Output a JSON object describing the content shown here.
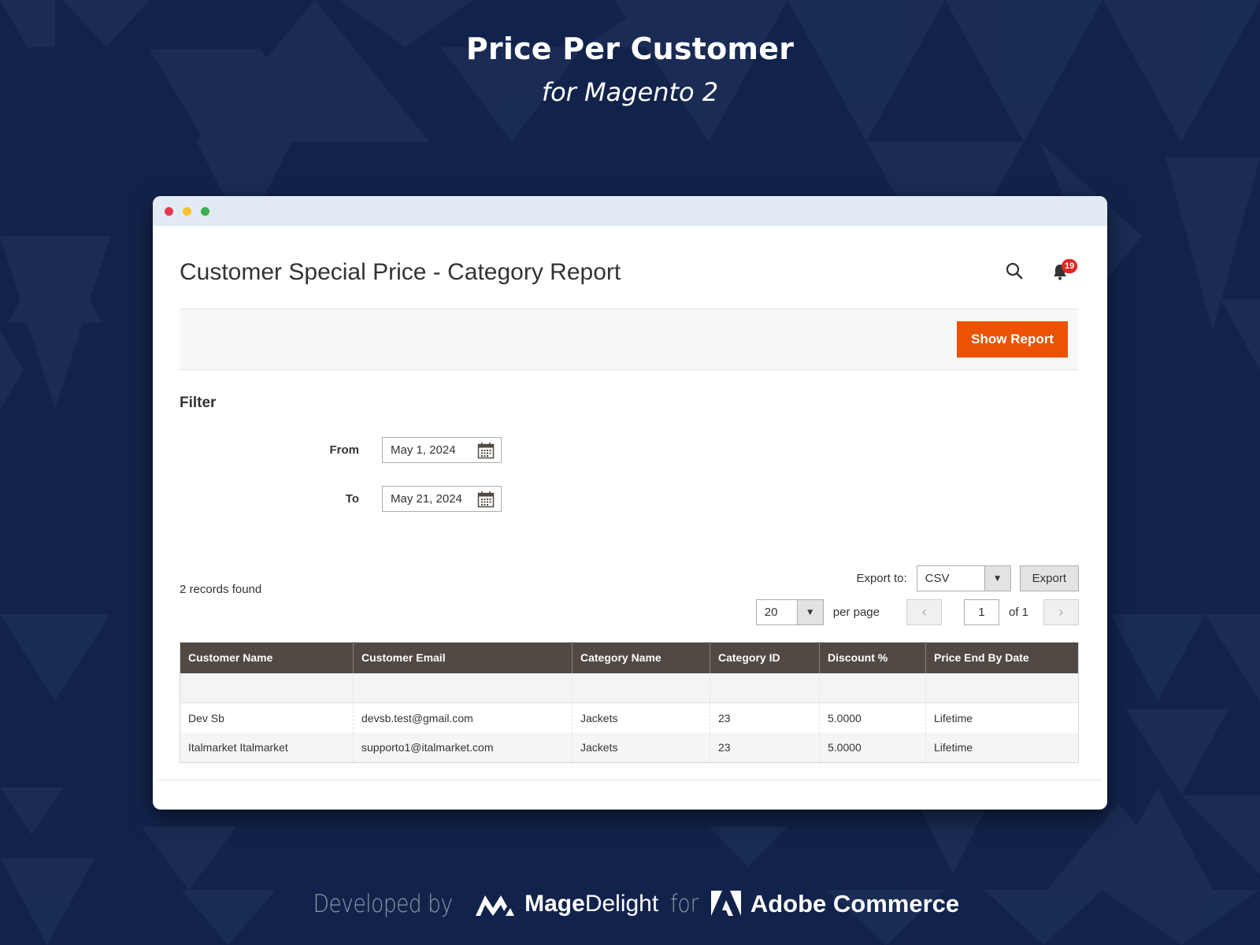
{
  "hero": {
    "title": "Price Per Customer",
    "subtitle": "for Magento 2"
  },
  "window": {
    "controls": [
      "close",
      "minimize",
      "maximize"
    ]
  },
  "header": {
    "page_title": "Customer Special Price - Category Report",
    "search_icon": "search-icon",
    "notifications_icon": "bell-icon",
    "notifications_count": "19"
  },
  "actions": {
    "show_report_label": "Show Report",
    "show_report_color": "#eb5202"
  },
  "filter": {
    "title": "Filter",
    "from_label": "From",
    "from_value": "May 1, 2024",
    "to_label": "To",
    "to_value": "May 21, 2024",
    "calendar_icon": "calendar-icon"
  },
  "export": {
    "label": "Export to:",
    "format_selected": "CSV",
    "button_label": "Export"
  },
  "grid": {
    "records_found": "2 records found",
    "per_page_selected": "20",
    "per_page_label": "per page",
    "current_page": "1",
    "page_of": "of 1",
    "columns": [
      "Customer Name",
      "Customer Email",
      "Category Name",
      "Category ID",
      "Discount %",
      "Price End By Date"
    ],
    "rows": [
      [
        "Dev Sb",
        "devsb.test@gmail.com",
        "Jackets",
        "23",
        "5.0000",
        "Lifetime"
      ],
      [
        "Italmarket Italmarket",
        "supporto1@italmarket.com",
        "Jackets",
        "23",
        "5.0000",
        "Lifetime"
      ]
    ],
    "header_color": "#514943"
  },
  "credits": {
    "developed_by": "Developed by",
    "brand_bold": "Mage",
    "brand_light": "Delight",
    "for": "for",
    "platform": "Adobe Commerce"
  }
}
